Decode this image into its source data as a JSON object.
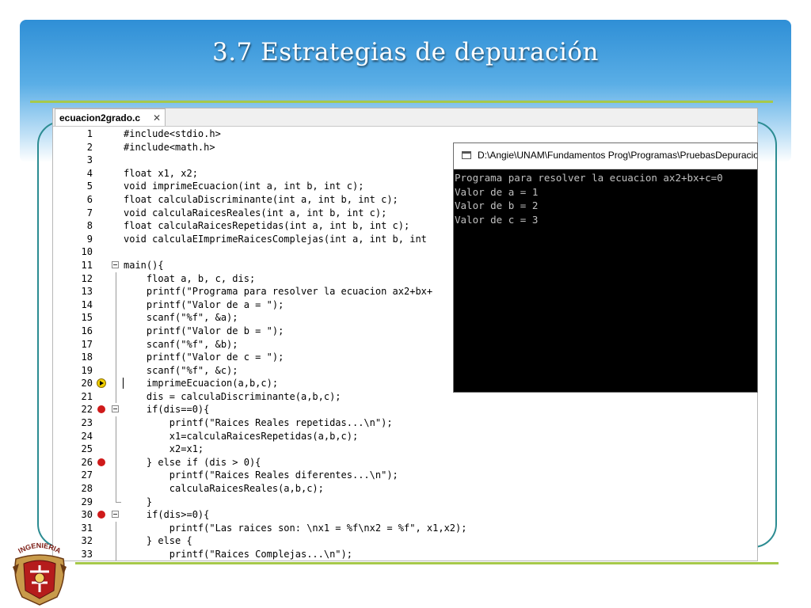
{
  "slide": {
    "title": "3.7  Estrategias de depuración",
    "logo_text": "INGENIERIA"
  },
  "editor": {
    "tab_label": "ecuacion2grado.c",
    "tab_close": "✕",
    "lines": [
      {
        "n": "1",
        "code": "#include<stdio.h>",
        "marker": "none",
        "fold": "none"
      },
      {
        "n": "2",
        "code": "#include<math.h>",
        "marker": "none",
        "fold": "none"
      },
      {
        "n": "3",
        "code": "",
        "marker": "none",
        "fold": "none"
      },
      {
        "n": "4",
        "code": "float x1, x2;",
        "marker": "none",
        "fold": "none"
      },
      {
        "n": "5",
        "code": "void imprimeEcuacion(int a, int b, int c);",
        "marker": "none",
        "fold": "none"
      },
      {
        "n": "6",
        "code": "float calculaDiscriminante(int a, int b, int c);",
        "marker": "none",
        "fold": "none"
      },
      {
        "n": "7",
        "code": "void calculaRaicesReales(int a, int b, int c);",
        "marker": "none",
        "fold": "none"
      },
      {
        "n": "8",
        "code": "float calculaRaicesRepetidas(int a, int b, int c);",
        "marker": "none",
        "fold": "none"
      },
      {
        "n": "9",
        "code": "void calculaEImprimeRaicesComplejas(int a, int b, int",
        "marker": "none",
        "fold": "none"
      },
      {
        "n": "10",
        "code": "",
        "marker": "none",
        "fold": "none"
      },
      {
        "n": "11",
        "code": "main(){",
        "marker": "none",
        "fold": "box"
      },
      {
        "n": "12",
        "code": "    float a, b, c, dis;",
        "marker": "none",
        "fold": "line"
      },
      {
        "n": "13",
        "code": "    printf(\"Programa para resolver la ecuacion ax2+bx+",
        "marker": "none",
        "fold": "line"
      },
      {
        "n": "14",
        "code": "    printf(\"Valor de a = \");",
        "marker": "none",
        "fold": "line"
      },
      {
        "n": "15",
        "code": "    scanf(\"%f\", &a);",
        "marker": "none",
        "fold": "line"
      },
      {
        "n": "16",
        "code": "    printf(\"Valor de b = \");",
        "marker": "none",
        "fold": "line"
      },
      {
        "n": "17",
        "code": "    scanf(\"%f\", &b);",
        "marker": "none",
        "fold": "line"
      },
      {
        "n": "18",
        "code": "    printf(\"Valor de c = \");",
        "marker": "none",
        "fold": "line"
      },
      {
        "n": "19",
        "code": "    scanf(\"%f\", &c);",
        "marker": "none",
        "fold": "line"
      },
      {
        "n": "20",
        "code": "    imprimeEcuacion(a,b,c);",
        "marker": "arrow",
        "fold": "cursor"
      },
      {
        "n": "21",
        "code": "    dis = calculaDiscriminante(a,b,c);",
        "marker": "none",
        "fold": "line"
      },
      {
        "n": "22",
        "code": "    if(dis==0){",
        "marker": "breakpoint",
        "fold": "box"
      },
      {
        "n": "23",
        "code": "        printf(\"Raices Reales repetidas...\\n\");",
        "marker": "none",
        "fold": "line"
      },
      {
        "n": "24",
        "code": "        x1=calculaRaicesRepetidas(a,b,c);",
        "marker": "none",
        "fold": "line"
      },
      {
        "n": "25",
        "code": "        x2=x1;",
        "marker": "none",
        "fold": "line"
      },
      {
        "n": "26",
        "code": "    } else if (dis > 0){",
        "marker": "breakpoint",
        "fold": "line"
      },
      {
        "n": "27",
        "code": "        printf(\"Raices Reales diferentes...\\n\");",
        "marker": "none",
        "fold": "line"
      },
      {
        "n": "28",
        "code": "        calculaRaicesReales(a,b,c);",
        "marker": "none",
        "fold": "line"
      },
      {
        "n": "29",
        "code": "    }",
        "marker": "none",
        "fold": "end"
      },
      {
        "n": "30",
        "code": "    if(dis>=0){",
        "marker": "breakpoint",
        "fold": "box"
      },
      {
        "n": "31",
        "code": "        printf(\"Las raices son: \\nx1 = %f\\nx2 = %f\", x1,x2);",
        "marker": "none",
        "fold": "line"
      },
      {
        "n": "32",
        "code": "    } else {",
        "marker": "none",
        "fold": "line"
      },
      {
        "n": "33",
        "code": "        printf(\"Raices Complejas...\\n\");",
        "marker": "none",
        "fold": "line"
      }
    ]
  },
  "console": {
    "title": "D:\\Angie\\UNAM\\Fundamentos Prog\\Programas\\PruebasDepuracion",
    "lines": [
      "Programa para resolver la ecuacion ax2+bx+c=0",
      "Valor de a = 1",
      "Valor de b = 2",
      "Valor de c = 3"
    ]
  },
  "colors": {
    "header_blue": "#2f8fd6",
    "accent_green": "#a6c94a",
    "frame_teal": "#2c8c92",
    "breakpoint_red": "#cf1a1a",
    "current_line_yellow": "#f2d100"
  }
}
